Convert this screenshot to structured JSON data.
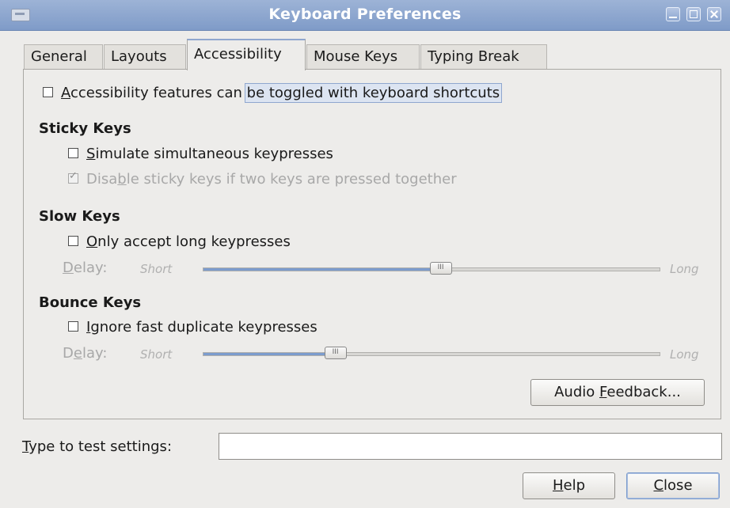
{
  "window": {
    "title": "Keyboard Preferences"
  },
  "tabs": [
    {
      "label": "General",
      "active": false
    },
    {
      "label": "Layouts",
      "active": false
    },
    {
      "label": "Accessibility",
      "active": true
    },
    {
      "label": "Mouse Keys",
      "active": false
    },
    {
      "label": "Typing Break",
      "active": false
    }
  ],
  "accessibility": {
    "toggle_shortcuts": {
      "label_pre": "A",
      "label_rest_a": "ccessibility features can ",
      "label_rest_b": "be toggled with keyboard shortcuts",
      "checked": false
    },
    "sticky_keys": {
      "heading": "Sticky Keys",
      "simulate": {
        "u": "S",
        "rest": "imulate simultaneous keypresses",
        "checked": false
      },
      "disable_two": {
        "pre": "Disa",
        "u": "b",
        "rest": "le sticky keys if two keys are pressed together",
        "checked": true,
        "enabled": false
      }
    },
    "slow_keys": {
      "heading": "Slow Keys",
      "only_long": {
        "u": "O",
        "rest": "nly accept long keypresses",
        "checked": false
      },
      "delay": {
        "u": "D",
        "rest": "elay:",
        "short": "Short",
        "long": "Long",
        "value_fraction": 0.52
      }
    },
    "bounce_keys": {
      "heading": "Bounce Keys",
      "ignore_fast": {
        "u": "I",
        "rest": "gnore fast duplicate keypresses",
        "checked": false
      },
      "delay": {
        "pre": "D",
        "u": "e",
        "rest": "lay:",
        "short": "Short",
        "long": "Long",
        "value_fraction": 0.29
      }
    },
    "audio_feedback": {
      "pre": "Audio ",
      "u": "F",
      "rest": "eedback..."
    }
  },
  "test_settings": {
    "u": "T",
    "rest": "ype to test settings:",
    "value": ""
  },
  "buttons": {
    "help": {
      "u": "H",
      "rest": "elp"
    },
    "close": {
      "u": "C",
      "rest": "lose"
    }
  }
}
